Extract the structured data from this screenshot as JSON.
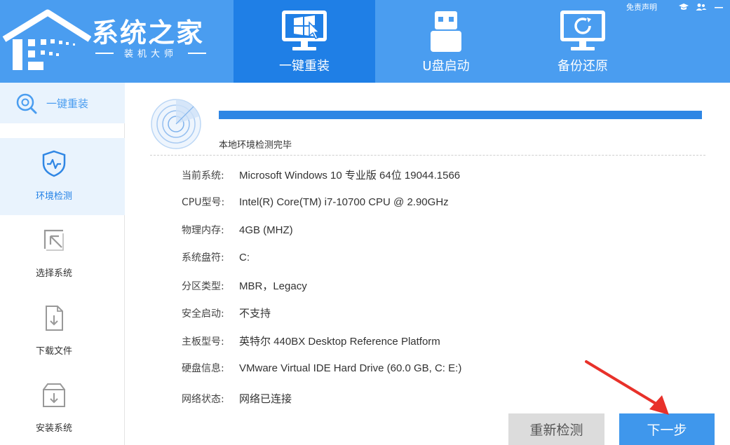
{
  "header": {
    "logo_title": "系统之家",
    "logo_subtitle": "装机大师",
    "tabs": [
      {
        "label": "一键重装",
        "icon": "windows-monitor-icon",
        "active": true
      },
      {
        "label": "U盘启动",
        "icon": "usb-drive-icon",
        "active": false
      },
      {
        "label": "备份还原",
        "icon": "restore-monitor-icon",
        "active": false
      }
    ],
    "topbar": {
      "disclaimer": "免责声明",
      "icons": [
        "graduation-cap-icon",
        "users-icon",
        "minimize-icon"
      ]
    },
    "colors": {
      "header": "#4a9df0",
      "active_tab": "#1f7fe6"
    }
  },
  "sidebar": {
    "top_label": "一键重装",
    "items": [
      {
        "label": "环境检测",
        "icon": "shield-pulse-icon",
        "active": true
      },
      {
        "label": "选择系统",
        "icon": "cursor-select-icon",
        "active": false
      },
      {
        "label": "下载文件",
        "icon": "file-download-icon",
        "active": false
      },
      {
        "label": "安装系统",
        "icon": "install-box-icon",
        "active": false
      }
    ]
  },
  "main": {
    "progress": 1.0,
    "status": "本地环境检测完毕",
    "info": [
      {
        "key": "当前系统:",
        "value": "Microsoft Windows 10 专业版 64位 19044.1566"
      },
      {
        "key": "CPU型号:",
        "value": "Intel(R) Core(TM) i7-10700 CPU @ 2.90GHz"
      },
      {
        "key": "物理内存:",
        "value": "4GB (MHZ)"
      },
      {
        "key": "系统盘符:",
        "value": "C:"
      },
      {
        "key": "分区类型:",
        "value": "MBR，Legacy"
      },
      {
        "key": "安全启动:",
        "value": "不支持"
      },
      {
        "key": "主板型号:",
        "value": "英特尔 440BX Desktop Reference Platform"
      },
      {
        "key": "硬盘信息:",
        "value": "VMware Virtual IDE Hard Drive  (60.0 GB, C: E:)"
      },
      {
        "key": "网络状态:",
        "value": "网络已连接"
      }
    ],
    "buttons": {
      "recheck": "重新检测",
      "next": "下一步"
    }
  }
}
